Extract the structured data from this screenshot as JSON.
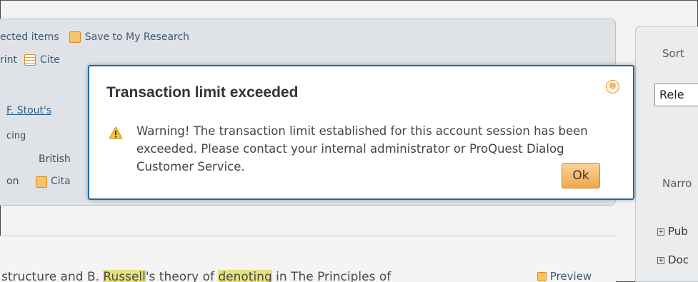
{
  "toolbar": {
    "row1_selected_label": "ected items",
    "save_label": "Save to My Research",
    "print_label": "rint",
    "cite_label": "Cite"
  },
  "result1": {
    "title_fragment": "F. Stout's",
    "line2_fragment": "cing",
    "line3_fragment": "British",
    "line4_prefix": "on",
    "citation_fragment": "Cita"
  },
  "result2": {
    "text_a": "structure and B. ",
    "highlight1": "Russell",
    "text_b": "'s theory of ",
    "highlight2": "denoting",
    "text_c": " in The Principles of",
    "preview_label": "Preview"
  },
  "sidebar": {
    "sort_label": "Sort",
    "sort_value": "Rele",
    "narrow_label": "Narro",
    "facet1": "Pub",
    "facet2": "Doc"
  },
  "modal": {
    "title": "Transaction limit exceeded",
    "message": "Warning! The transaction limit established for this account session has been exceeded. Please contact your internal administrator or ProQuest Dialog Customer Service.",
    "ok_label": "Ok",
    "close_glyph": "⊗",
    "warning_icon": "warning-triangle-icon"
  },
  "colors": {
    "modal_border": "#1c6ca6",
    "accent_orange": "#f0962e",
    "highlight": "#e6e279",
    "link": "#2a5d8a"
  }
}
